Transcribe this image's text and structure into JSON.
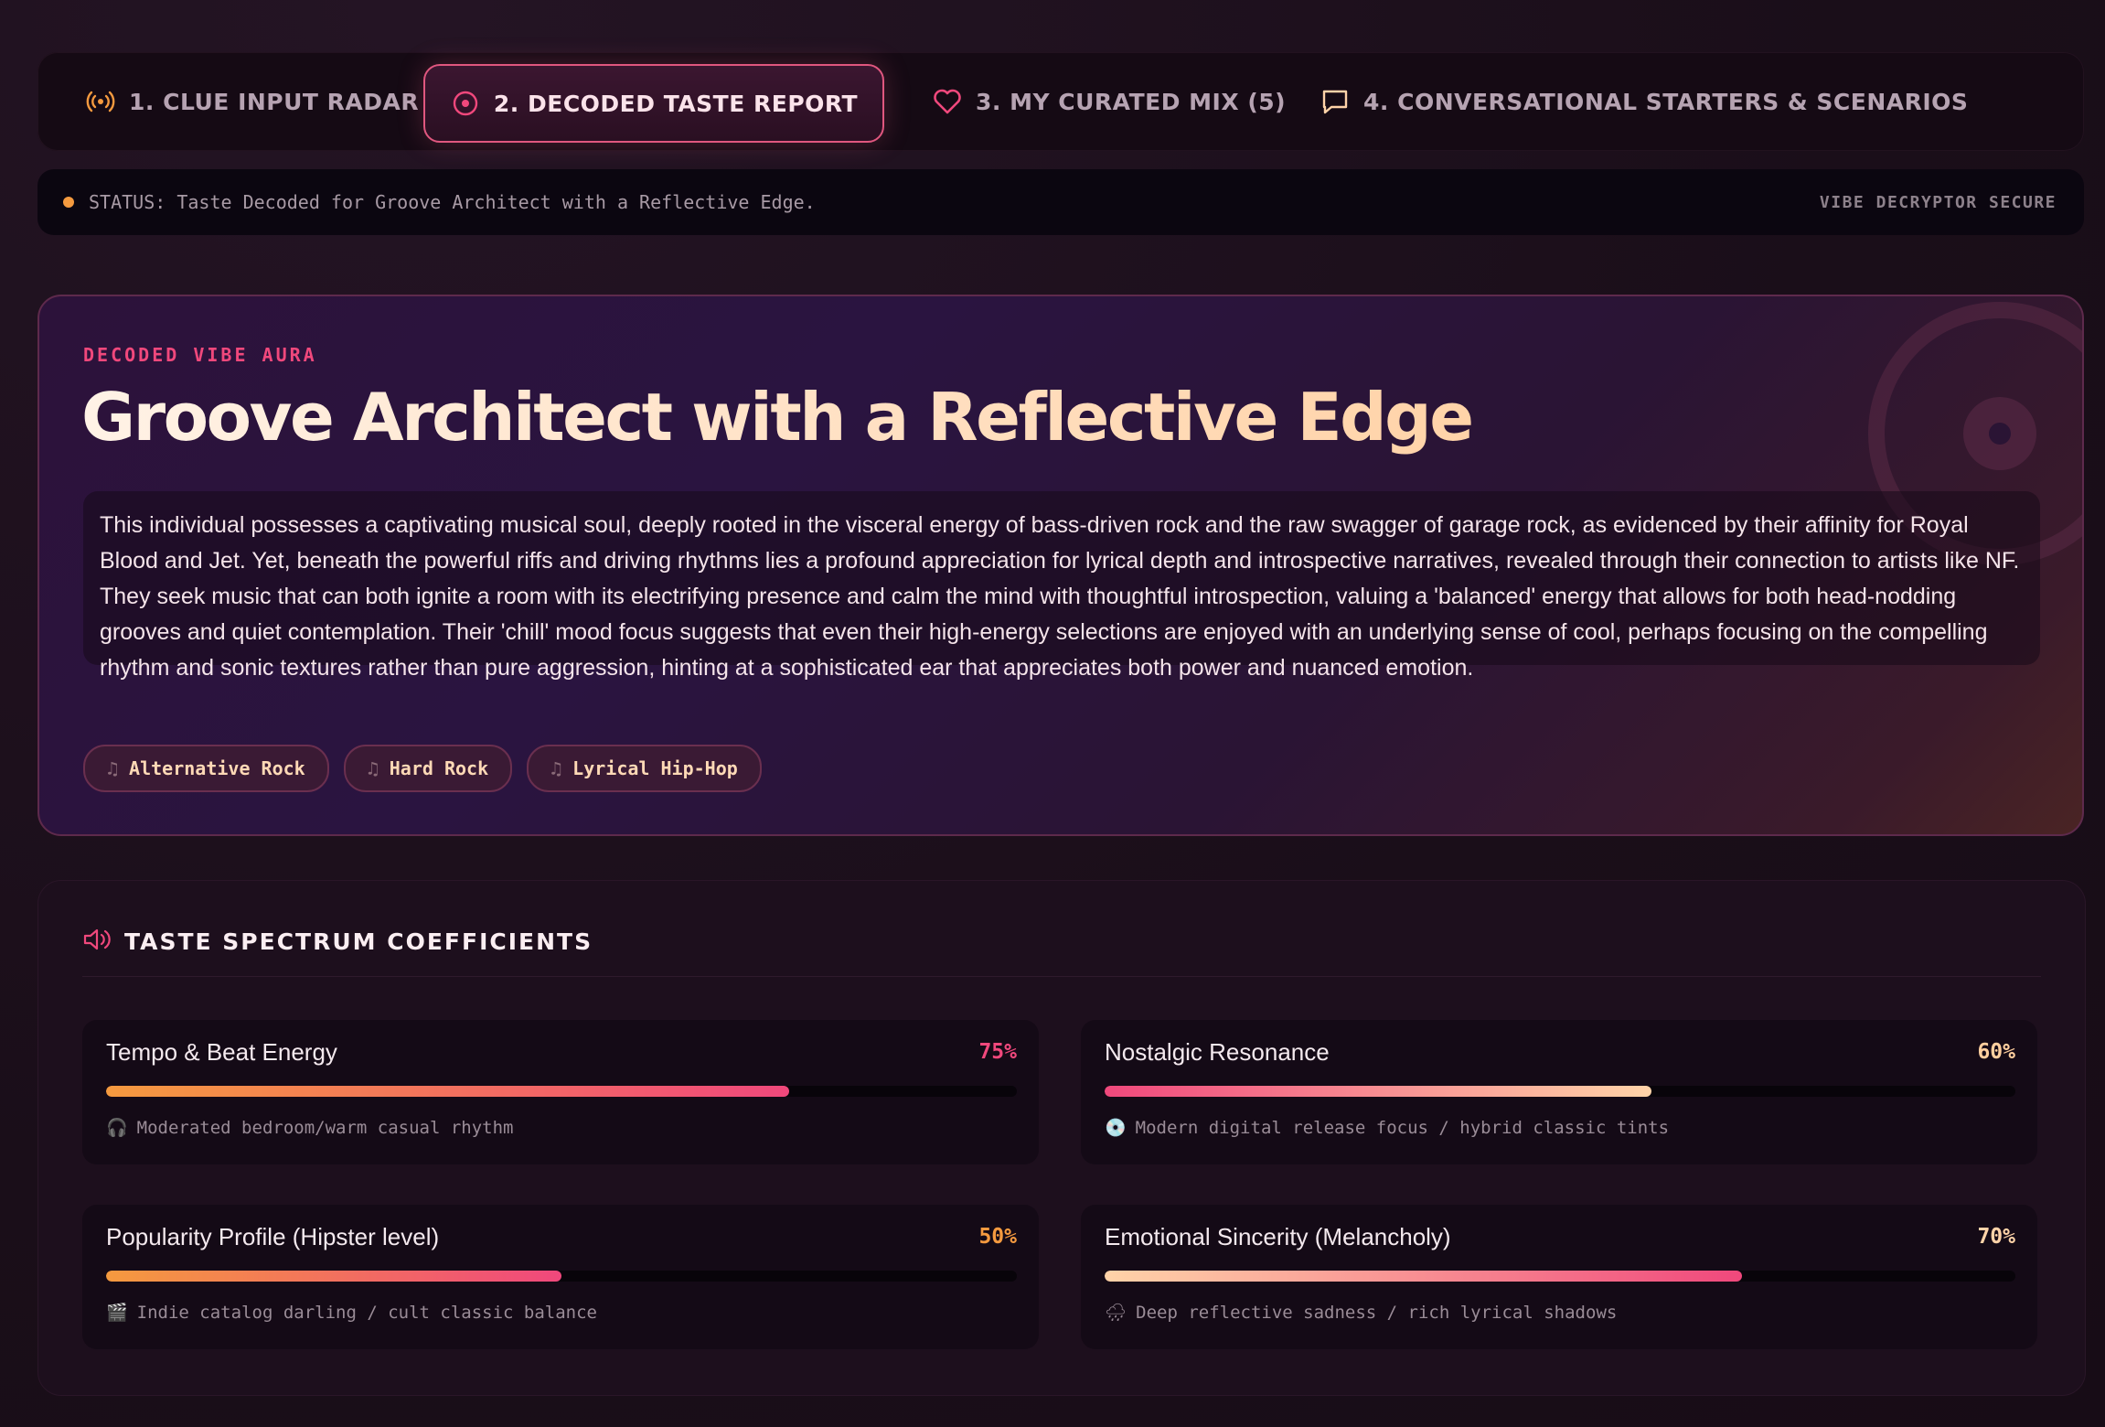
{
  "tabs": [
    {
      "label": "1. CLUE INPUT RADAR",
      "icon": "radar-icon",
      "active": false
    },
    {
      "label": "2. DECODED TASTE REPORT",
      "icon": "target-icon",
      "active": true
    },
    {
      "label": "3. MY CURATED MIX (5)",
      "icon": "heart-icon",
      "active": false
    },
    {
      "label": "4. CONVERSATIONAL STARTERS & SCENARIOS",
      "icon": "chat-icon",
      "active": false
    }
  ],
  "status": {
    "text": "STATUS: Taste Decoded for Groove Architect with a Reflective Edge.",
    "badge": "VIBE DECRYPTOR SECURE"
  },
  "hero": {
    "eyebrow": "DECODED VIBE AURA",
    "title": "Groove Architect with a Reflective Edge",
    "description": "This individual possesses a captivating musical soul, deeply rooted in the visceral energy of bass-driven rock and the raw swagger of garage rock, as evidenced by their affinity for Royal Blood and Jet. Yet, beneath the powerful riffs and driving rhythms lies a profound appreciation for lyrical depth and introspective narratives, revealed through their connection to artists like NF. They seek music that can both ignite a room with its electrifying presence and calm the mind with thoughtful introspection, valuing a 'balanced' energy that allows for both head-nodding grooves and quiet contemplation. Their 'chill' mood focus suggests that even their high-energy selections are enjoyed with an underlying sense of cool, perhaps focusing on the compelling rhythm and sonic textures rather than pure aggression, hinting at a sophisticated ear that appreciates both power and nuanced emotion.",
    "genres": [
      "Alternative Rock",
      "Hard Rock",
      "Lyrical Hip-Hop"
    ],
    "genre_icon": "music-note-icon"
  },
  "spectrum": {
    "title": "TASTE SPECTRUM COEFFICIENTS",
    "icon": "speaker-icon",
    "metrics": [
      {
        "name": "Tempo & Beat Energy",
        "percent": "75%",
        "value": 75,
        "note": "Moderated bedroom/warm casual rhythm",
        "emoji": "🎧",
        "pct_color": "#f0487c"
      },
      {
        "name": "Nostalgic Resonance",
        "percent": "60%",
        "value": 60,
        "note": "Modern digital release focus / hybrid classic tints",
        "emoji": "💿",
        "pct_color": "#ffcf9e"
      },
      {
        "name": "Popularity Profile (Hipster level)",
        "percent": "50%",
        "value": 50,
        "note": "Indie catalog darling / cult classic balance",
        "emoji": "🎬",
        "pct_color": "#f59a3f"
      },
      {
        "name": "Emotional Sincerity (Melancholy)",
        "percent": "70%",
        "value": 70,
        "note": "Deep reflective sadness / rich lyrical shadows",
        "emoji": "🌧",
        "pct_color": "#ffd3a8"
      }
    ]
  },
  "colors": {
    "accent": "#f0487c",
    "orange": "#f59a3f",
    "peach": "#ffd3a8",
    "background": "#1c0f1b"
  }
}
